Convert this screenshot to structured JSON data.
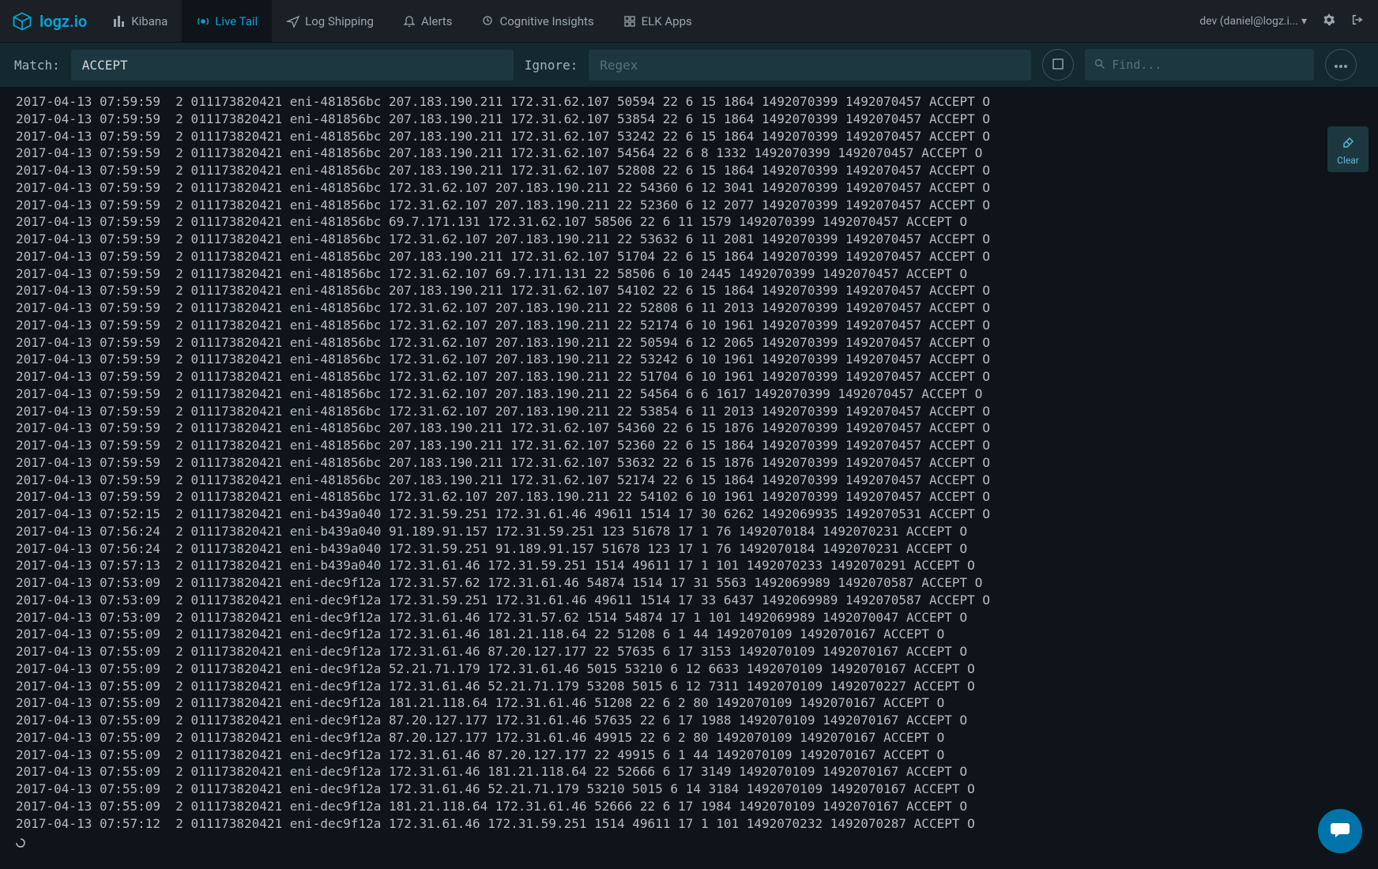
{
  "brand": "logz.io",
  "nav": {
    "items": [
      {
        "label": "Kibana",
        "icon": "bars"
      },
      {
        "label": "Live Tail",
        "icon": "radio",
        "active": true
      },
      {
        "label": "Log Shipping",
        "icon": "plane"
      },
      {
        "label": "Alerts",
        "icon": "bell"
      },
      {
        "label": "Cognitive Insights",
        "icon": "head"
      },
      {
        "label": "ELK Apps",
        "icon": "apps"
      }
    ]
  },
  "user_label": "dev (daniel@logz.i...",
  "filter": {
    "match_label": "Match:",
    "match_value": "ACCEPT",
    "ignore_label": "Ignore:",
    "ignore_placeholder": "Regex",
    "find_placeholder": "Find..."
  },
  "clear_label": "Clear",
  "log_lines": [
    "2017-04-13 07:59:59  2 011173820421 eni-481856bc 207.183.190.211 172.31.62.107 50594 22 6 15 1864 1492070399 1492070457 ACCEPT O",
    "2017-04-13 07:59:59  2 011173820421 eni-481856bc 207.183.190.211 172.31.62.107 53854 22 6 15 1864 1492070399 1492070457 ACCEPT O",
    "2017-04-13 07:59:59  2 011173820421 eni-481856bc 207.183.190.211 172.31.62.107 53242 22 6 15 1864 1492070399 1492070457 ACCEPT O",
    "2017-04-13 07:59:59  2 011173820421 eni-481856bc 207.183.190.211 172.31.62.107 54564 22 6 8 1332 1492070399 1492070457 ACCEPT O",
    "2017-04-13 07:59:59  2 011173820421 eni-481856bc 207.183.190.211 172.31.62.107 52808 22 6 15 1864 1492070399 1492070457 ACCEPT O",
    "2017-04-13 07:59:59  2 011173820421 eni-481856bc 172.31.62.107 207.183.190.211 22 54360 6 12 3041 1492070399 1492070457 ACCEPT O",
    "2017-04-13 07:59:59  2 011173820421 eni-481856bc 172.31.62.107 207.183.190.211 22 52360 6 12 2077 1492070399 1492070457 ACCEPT O",
    "2017-04-13 07:59:59  2 011173820421 eni-481856bc 69.7.171.131 172.31.62.107 58506 22 6 11 1579 1492070399 1492070457 ACCEPT O",
    "2017-04-13 07:59:59  2 011173820421 eni-481856bc 172.31.62.107 207.183.190.211 22 53632 6 11 2081 1492070399 1492070457 ACCEPT O",
    "2017-04-13 07:59:59  2 011173820421 eni-481856bc 207.183.190.211 172.31.62.107 51704 22 6 15 1864 1492070399 1492070457 ACCEPT O",
    "2017-04-13 07:59:59  2 011173820421 eni-481856bc 172.31.62.107 69.7.171.131 22 58506 6 10 2445 1492070399 1492070457 ACCEPT O",
    "2017-04-13 07:59:59  2 011173820421 eni-481856bc 207.183.190.211 172.31.62.107 54102 22 6 15 1864 1492070399 1492070457 ACCEPT O",
    "2017-04-13 07:59:59  2 011173820421 eni-481856bc 172.31.62.107 207.183.190.211 22 52808 6 11 2013 1492070399 1492070457 ACCEPT O",
    "2017-04-13 07:59:59  2 011173820421 eni-481856bc 172.31.62.107 207.183.190.211 22 52174 6 10 1961 1492070399 1492070457 ACCEPT O",
    "2017-04-13 07:59:59  2 011173820421 eni-481856bc 172.31.62.107 207.183.190.211 22 50594 6 12 2065 1492070399 1492070457 ACCEPT O",
    "2017-04-13 07:59:59  2 011173820421 eni-481856bc 172.31.62.107 207.183.190.211 22 53242 6 10 1961 1492070399 1492070457 ACCEPT O",
    "2017-04-13 07:59:59  2 011173820421 eni-481856bc 172.31.62.107 207.183.190.211 22 51704 6 10 1961 1492070399 1492070457 ACCEPT O",
    "2017-04-13 07:59:59  2 011173820421 eni-481856bc 172.31.62.107 207.183.190.211 22 54564 6 6 1617 1492070399 1492070457 ACCEPT O",
    "2017-04-13 07:59:59  2 011173820421 eni-481856bc 172.31.62.107 207.183.190.211 22 53854 6 11 2013 1492070399 1492070457 ACCEPT O",
    "2017-04-13 07:59:59  2 011173820421 eni-481856bc 207.183.190.211 172.31.62.107 54360 22 6 15 1876 1492070399 1492070457 ACCEPT O",
    "2017-04-13 07:59:59  2 011173820421 eni-481856bc 207.183.190.211 172.31.62.107 52360 22 6 15 1864 1492070399 1492070457 ACCEPT O",
    "2017-04-13 07:59:59  2 011173820421 eni-481856bc 207.183.190.211 172.31.62.107 53632 22 6 15 1876 1492070399 1492070457 ACCEPT O",
    "2017-04-13 07:59:59  2 011173820421 eni-481856bc 207.183.190.211 172.31.62.107 52174 22 6 15 1864 1492070399 1492070457 ACCEPT O",
    "2017-04-13 07:59:59  2 011173820421 eni-481856bc 172.31.62.107 207.183.190.211 22 54102 6 10 1961 1492070399 1492070457 ACCEPT O",
    "2017-04-13 07:52:15  2 011173820421 eni-b439a040 172.31.59.251 172.31.61.46 49611 1514 17 30 6262 1492069935 1492070531 ACCEPT O",
    "2017-04-13 07:56:24  2 011173820421 eni-b439a040 91.189.91.157 172.31.59.251 123 51678 17 1 76 1492070184 1492070231 ACCEPT O",
    "2017-04-13 07:56:24  2 011173820421 eni-b439a040 172.31.59.251 91.189.91.157 51678 123 17 1 76 1492070184 1492070231 ACCEPT O",
    "2017-04-13 07:57:13  2 011173820421 eni-b439a040 172.31.61.46 172.31.59.251 1514 49611 17 1 101 1492070233 1492070291 ACCEPT O",
    "2017-04-13 07:53:09  2 011173820421 eni-dec9f12a 172.31.57.62 172.31.61.46 54874 1514 17 31 5563 1492069989 1492070587 ACCEPT O",
    "2017-04-13 07:53:09  2 011173820421 eni-dec9f12a 172.31.59.251 172.31.61.46 49611 1514 17 33 6437 1492069989 1492070587 ACCEPT O",
    "2017-04-13 07:53:09  2 011173820421 eni-dec9f12a 172.31.61.46 172.31.57.62 1514 54874 17 1 101 1492069989 1492070047 ACCEPT O",
    "2017-04-13 07:55:09  2 011173820421 eni-dec9f12a 172.31.61.46 181.21.118.64 22 51208 6 1 44 1492070109 1492070167 ACCEPT O",
    "2017-04-13 07:55:09  2 011173820421 eni-dec9f12a 172.31.61.46 87.20.127.177 22 57635 6 17 3153 1492070109 1492070167 ACCEPT O",
    "2017-04-13 07:55:09  2 011173820421 eni-dec9f12a 52.21.71.179 172.31.61.46 5015 53210 6 12 6633 1492070109 1492070167 ACCEPT O",
    "2017-04-13 07:55:09  2 011173820421 eni-dec9f12a 172.31.61.46 52.21.71.179 53208 5015 6 12 7311 1492070109 1492070227 ACCEPT O",
    "2017-04-13 07:55:09  2 011173820421 eni-dec9f12a 181.21.118.64 172.31.61.46 51208 22 6 2 80 1492070109 1492070167 ACCEPT O",
    "2017-04-13 07:55:09  2 011173820421 eni-dec9f12a 87.20.127.177 172.31.61.46 57635 22 6 17 1988 1492070109 1492070167 ACCEPT O",
    "2017-04-13 07:55:09  2 011173820421 eni-dec9f12a 87.20.127.177 172.31.61.46 49915 22 6 2 80 1492070109 1492070167 ACCEPT O",
    "2017-04-13 07:55:09  2 011173820421 eni-dec9f12a 172.31.61.46 87.20.127.177 22 49915 6 1 44 1492070109 1492070167 ACCEPT O",
    "2017-04-13 07:55:09  2 011173820421 eni-dec9f12a 172.31.61.46 181.21.118.64 22 52666 6 17 3149 1492070109 1492070167 ACCEPT O",
    "2017-04-13 07:55:09  2 011173820421 eni-dec9f12a 172.31.61.46 52.21.71.179 53210 5015 6 14 3184 1492070109 1492070167 ACCEPT O",
    "2017-04-13 07:55:09  2 011173820421 eni-dec9f12a 181.21.118.64 172.31.61.46 52666 22 6 17 1984 1492070109 1492070167 ACCEPT O",
    "2017-04-13 07:57:12  2 011173820421 eni-dec9f12a 172.31.61.46 172.31.59.251 1514 49611 17 1 101 1492070232 1492070287 ACCEPT O"
  ]
}
